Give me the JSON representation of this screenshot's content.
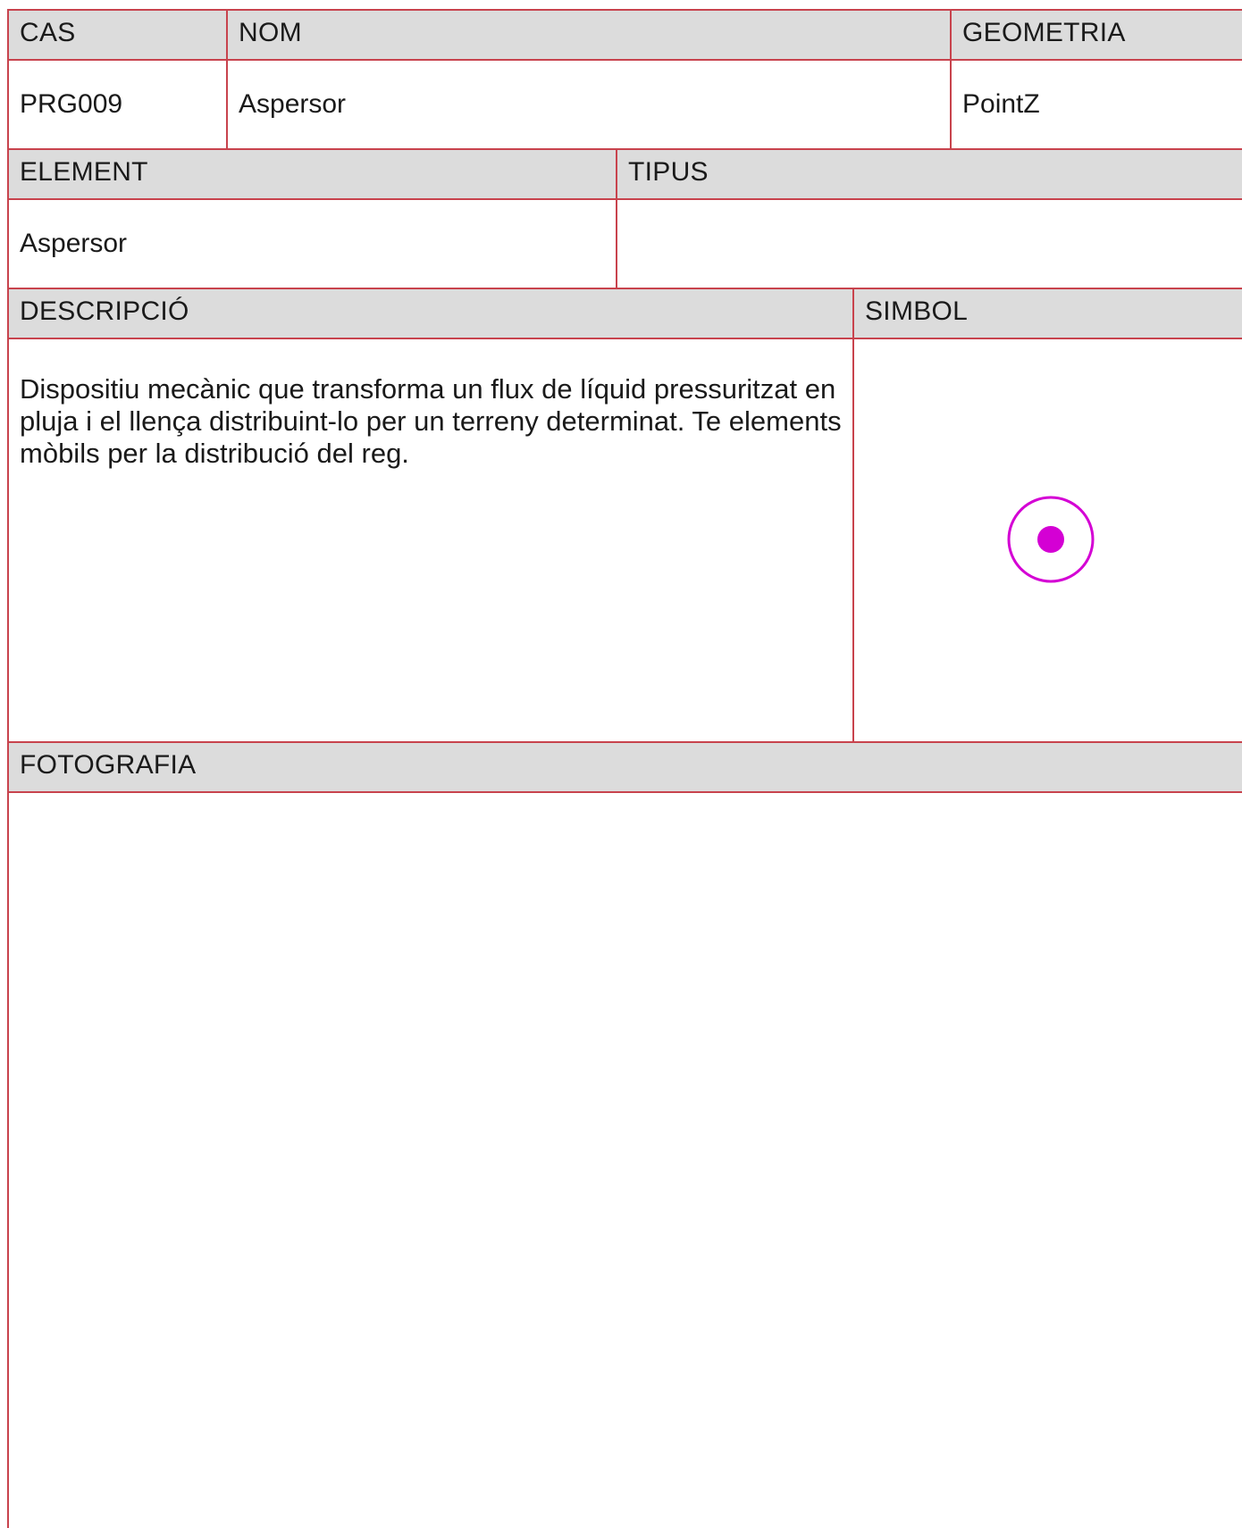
{
  "sheet": {
    "cas": {
      "label": "CAS",
      "value": "PRG009"
    },
    "nom": {
      "label": "NOM",
      "value": "Aspersor"
    },
    "geometria": {
      "label": "GEOMETRIA",
      "value": "PointZ"
    },
    "element": {
      "label": "ELEMENT",
      "value": "Aspersor"
    },
    "tipus": {
      "label": "TIPUS",
      "value": ""
    },
    "descripcio": {
      "label": "DESCRIPCIÓ",
      "value": "Dispositiu mecànic que transforma un flux de líquid pressuritzat en pluja i el llença distribuint-lo per un terreny determinat. Te elements mòbils per la distribució del reg."
    },
    "simbol": {
      "label": "SIMBOL",
      "icon": "sprinkler-point-symbol-icon",
      "color": "#d400d4"
    },
    "fotografia": {
      "label": "FOTOGRAFIA"
    }
  },
  "colors": {
    "border": "#c8434d",
    "header_bg": "#dcdcdc",
    "symbol": "#d400d4"
  }
}
